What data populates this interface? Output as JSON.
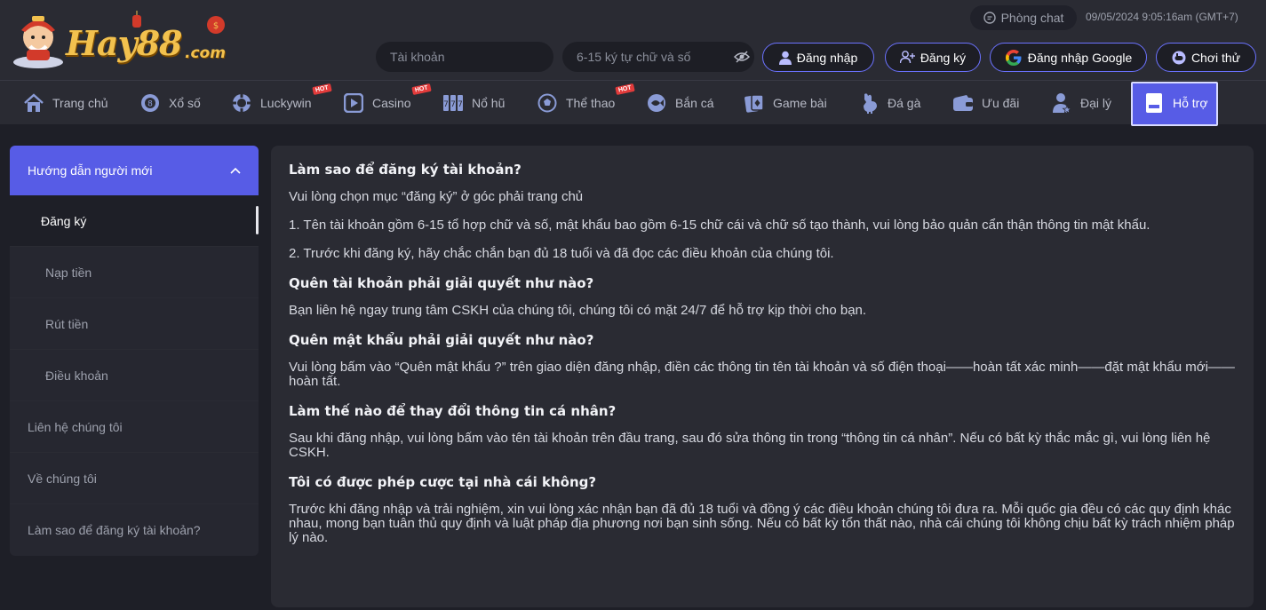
{
  "header": {
    "logo_text": "Hay88",
    "logo_suffix": ".com",
    "chat_label": "Phòng chat",
    "datetime": "09/05/2024 9:05:16am",
    "timezone": "(GMT+7)",
    "username_placeholder": "Tài khoản",
    "password_placeholder": "6-15 ký tự chữ và số",
    "login_label": "Đăng nhập",
    "register_label": "Đăng ký",
    "google_label": "Đăng nhập Google",
    "try_label": "Chơi thử"
  },
  "nav": {
    "hot_badge": "HOT",
    "items": [
      {
        "label": "Trang chủ",
        "icon": "home-icon"
      },
      {
        "label": "Xổ số",
        "icon": "lottery-icon"
      },
      {
        "label": "Luckywin",
        "icon": "chip-icon"
      },
      {
        "label": "Casino",
        "icon": "play-icon"
      },
      {
        "label": "Nổ hũ",
        "icon": "slot-icon"
      },
      {
        "label": "Thể thao",
        "icon": "soccer-icon"
      },
      {
        "label": "Bắn cá",
        "icon": "fish-icon"
      },
      {
        "label": "Game bài",
        "icon": "cards-icon"
      },
      {
        "label": "Đá gà",
        "icon": "rooster-icon"
      },
      {
        "label": "Ưu đãi",
        "icon": "wallet-icon"
      },
      {
        "label": "Đại lý",
        "icon": "agent-icon"
      },
      {
        "label": "Hỗ trợ",
        "icon": "book-icon"
      }
    ]
  },
  "sidebar": {
    "group_title": "Hướng dẫn người mới",
    "sub_items": [
      "Đăng ký",
      "Nạp tiền",
      "Rút tiền",
      "Điều khoản"
    ],
    "top_items": [
      "Liên hệ chúng tôi",
      "Về chúng tôi",
      "Làm sao để đăng ký tài khoản?"
    ]
  },
  "content": {
    "q1": "Làm sao để đăng ký tài khoản?",
    "a1_1": "Vui lòng chọn mục “đăng ký” ở góc phải trang chủ",
    "a1_2": "1. Tên tài khoản gồm 6-15 tổ hợp chữ và số, mật khẩu bao gồm 6-15 chữ cái và chữ số tạo thành, vui lòng bảo quản cẩn thận thông tin mật khẩu.",
    "a1_3": "2. Trước khi đăng ký, hãy chắc chắn bạn đủ 18 tuổi và đã đọc các điều khoản của chúng tôi.",
    "q2": "Quên tài khoản phải giải quyết như nào?",
    "a2": "Bạn liên hệ ngay trung tâm CSKH của chúng tôi, chúng tôi có mặt 24/7 để hỗ trợ kịp thời cho bạn.",
    "q3": "Quên mật khẩu phải giải quyết như nào?",
    "a3": "Vui lòng bấm vào “Quên mật khẩu ?” trên giao diện đăng nhập, điền các thông tin tên tài khoản và số điện thoại——hoàn tất xác minh——đặt mật khẩu mới——hoàn tất.",
    "q4": "Làm thế nào để thay đổi thông tin cá nhân?",
    "a4": "Sau khi đăng nhập, vui lòng bấm vào tên tài khoản trên đầu trang, sau đó sửa thông tin trong “thông tin cá nhân”. Nếu có bất kỳ thắc mắc gì, vui lòng liên hệ CSKH.",
    "q5": "Tôi có được phép cược tại nhà cái không?",
    "a5": "Trước khi đăng nhập và trải nghiệm, xin vui lòng xác nhận bạn đã đủ 18 tuổi và đồng ý các điều khoản chúng tôi đưa ra. Mỗi quốc gia đều có các quy định khác nhau, mong bạn tuân thủ quy định và luật pháp địa phương nơi bạn sinh sống. Nếu có bất kỳ tổn thất nào, nhà cái chúng tôi không chịu bất kỳ trách nhiệm pháp lý nào."
  },
  "colors": {
    "accent": "#575ce6",
    "button_border": "#6b72ff",
    "header_bg": "#2a2b33",
    "page_bg": "#1e1f27",
    "hot_badge": "#e23b3b",
    "logo_gold": "#f2c14e"
  }
}
